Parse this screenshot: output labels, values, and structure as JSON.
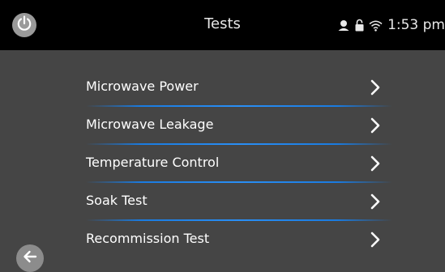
{
  "header": {
    "title": "Tests",
    "time": "1:53 pm",
    "power_icon": "power-icon",
    "status_icons": [
      "user-icon",
      "lock-icon",
      "wifi-icon"
    ]
  },
  "menu": {
    "items": [
      {
        "label": "Microwave Power"
      },
      {
        "label": "Microwave Leakage"
      },
      {
        "label": "Temperature Control"
      },
      {
        "label": "Soak Test"
      },
      {
        "label": "Recommission Test"
      }
    ]
  },
  "footer": {
    "back_icon": "arrow-left-icon"
  },
  "colors": {
    "background": "#454545",
    "topbar": "#000000",
    "accent": "#2a8ff5",
    "button_gray": "#9a9a9a"
  }
}
